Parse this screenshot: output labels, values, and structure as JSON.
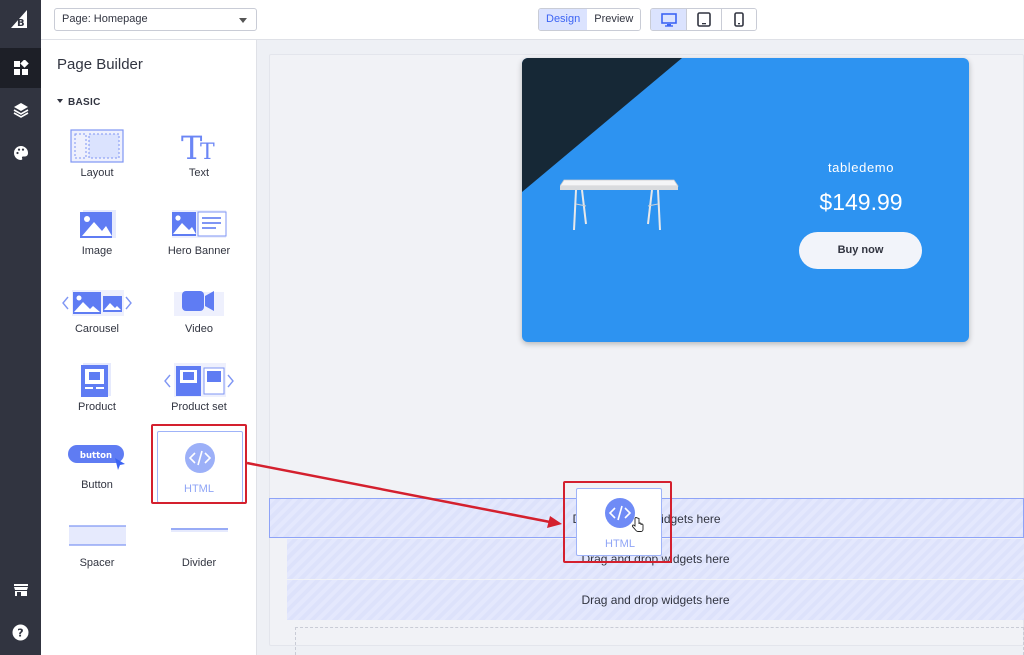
{
  "topbar": {
    "page_select": "Page: Homepage",
    "modes": [
      "Design",
      "Preview"
    ],
    "active_mode": "Design",
    "devices": [
      "desktop-icon",
      "tablet-icon",
      "mobile-icon"
    ]
  },
  "rail": {
    "items": [
      "bigcommerce-logo",
      "widgets-icon",
      "layers-icon",
      "palette-icon",
      "store-icon",
      "help-icon"
    ]
  },
  "panel": {
    "title": "Page Builder",
    "section": "BASIC",
    "widgets": [
      {
        "label": "Layout"
      },
      {
        "label": "Text"
      },
      {
        "label": "Image"
      },
      {
        "label": "Hero Banner"
      },
      {
        "label": "Carousel"
      },
      {
        "label": "Video"
      },
      {
        "label": "Product"
      },
      {
        "label": "Product set"
      },
      {
        "label": "Button",
        "icon_text": "button"
      },
      {
        "label": "HTML"
      },
      {
        "label": "Spacer"
      },
      {
        "label": "Divider"
      }
    ]
  },
  "hero": {
    "product_name": "tabledemo",
    "price": "$149.99",
    "button": "Buy now",
    "bg_color": "#2d93f1",
    "dark_color": "#162836"
  },
  "dropzones": [
    {
      "text": "Drag and drop widgets here"
    },
    {
      "text": "Drag and drop widgets here"
    },
    {
      "text": "Drag and drop widgets here"
    }
  ],
  "drag_preview": {
    "label": "HTML"
  },
  "colors": {
    "accent": "#3c64f4",
    "callout": "#d4202e",
    "rail": "#313440"
  }
}
